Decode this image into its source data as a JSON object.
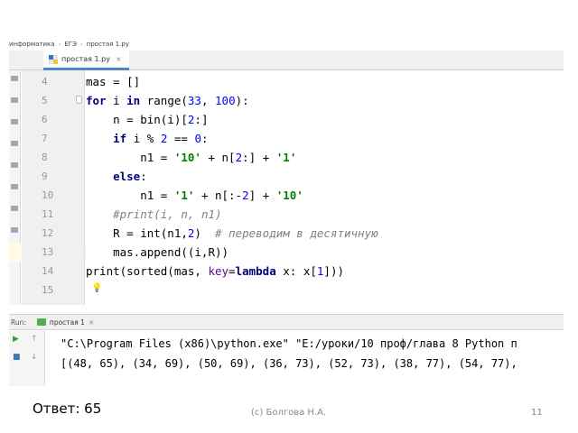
{
  "breadcrumb": [
    "информатика",
    "ЕГЭ",
    "простая 1.py"
  ],
  "tab": {
    "label": "простая 1.py"
  },
  "editor": {
    "line_numbers": [
      "4",
      "5",
      "6",
      "7",
      "8",
      "9",
      "10",
      "11",
      "12",
      "13",
      "14",
      "15"
    ],
    "current_line": "15"
  },
  "run_panel": {
    "label": "Run:",
    "config_name": "простая 1",
    "output": [
      "\"C:\\Program Files (x86)\\python.exe\" \"E:/уроки/10 проф/глава 8 Python п",
      "[(48, 65), (34, 69), (50, 69), (36, 73), (52, 73), (38, 77), (54, 77),"
    ]
  },
  "slide": {
    "answer": "Ответ: 65",
    "author": "(c) Болгова Н.А.",
    "page_number": "11"
  },
  "colors": {
    "keyword": "#000080",
    "number": "#0000ff",
    "string": "#008000",
    "comment": "#808080",
    "param": "#660099",
    "current_line_bg": "#fffbe6"
  },
  "icons": [
    "python-file-icon",
    "run-icon",
    "rerun-icon",
    "lightbulb-icon",
    "fold-icon"
  ]
}
